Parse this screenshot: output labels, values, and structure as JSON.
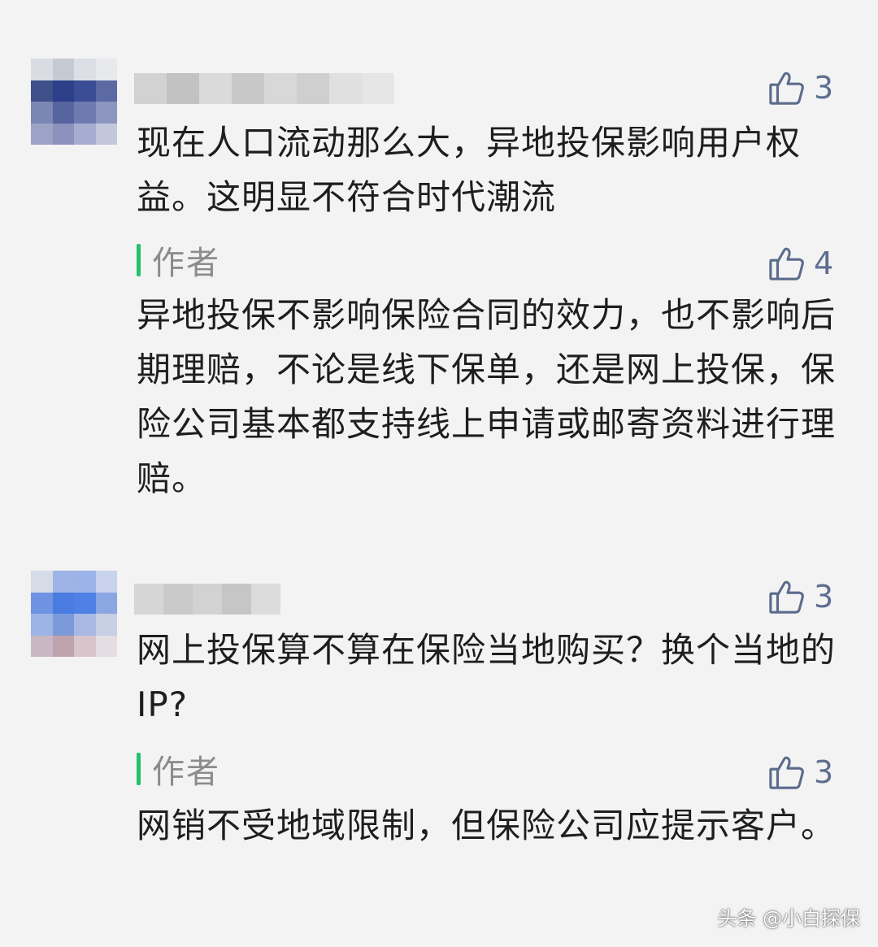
{
  "comments": [
    {
      "likes": "3",
      "text": "现在人口流动那么大，异地投保影响用户权益。这明显不符合时代潮流",
      "reply": {
        "author_label": "作者",
        "likes": "4",
        "text": "异地投保不影响保险合同的效力，也不影响后期理赔，不论是线下保单，还是网上投保，保险公司基本都支持线上申请或邮寄资料进行理赔。"
      }
    },
    {
      "likes": "3",
      "text": "网上投保算不算在保险当地购买？换个当地的IP?",
      "reply": {
        "author_label": "作者",
        "likes": "3",
        "text": "网销不受地域限制，但保险公司应提示客户。"
      }
    }
  ],
  "icons": {
    "like": "thumbs-up-icon"
  },
  "colors": {
    "author_bar": "#23c26a",
    "like": "#5a6b8c"
  },
  "watermark": "头条 @小白探保"
}
